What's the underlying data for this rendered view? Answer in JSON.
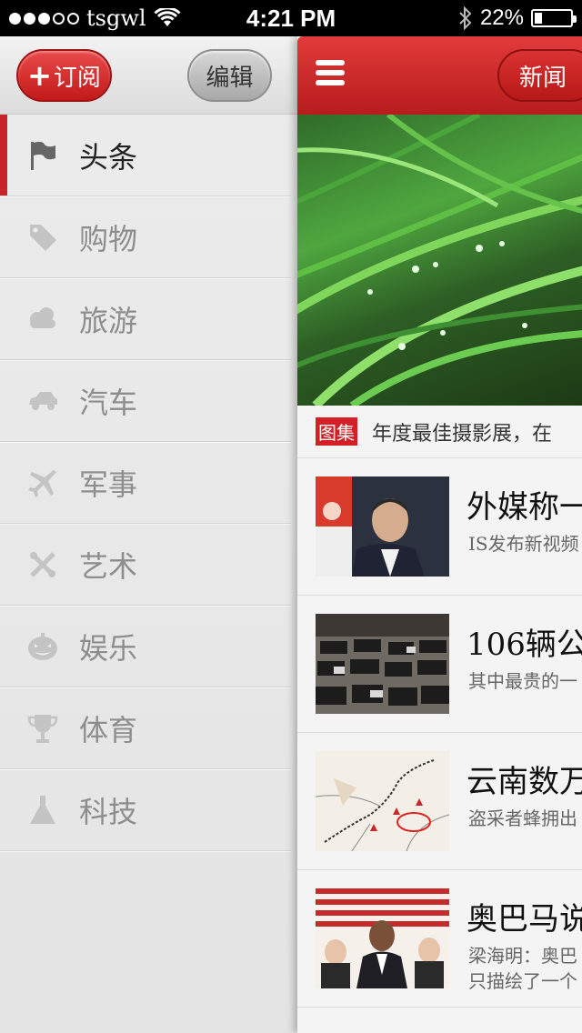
{
  "status_bar": {
    "carrier": "tsgwl",
    "time": "4:21 PM",
    "battery_percent": "22%",
    "battery_level": 0.22,
    "signal_bars_filled": 3,
    "signal_bars_total": 5
  },
  "sidebar": {
    "subscribe_label": "订阅",
    "edit_label": "编辑",
    "items": [
      {
        "label": "头条",
        "icon": "flag-icon",
        "active": true
      },
      {
        "label": "购物",
        "icon": "tag-icon",
        "active": false
      },
      {
        "label": "旅游",
        "icon": "cloud-icon",
        "active": false
      },
      {
        "label": "汽车",
        "icon": "car-icon",
        "active": false
      },
      {
        "label": "军事",
        "icon": "airplane-icon",
        "active": false
      },
      {
        "label": "艺术",
        "icon": "art-icon",
        "active": false
      },
      {
        "label": "娱乐",
        "icon": "pumpkin-icon",
        "active": false
      },
      {
        "label": "体育",
        "icon": "trophy-icon",
        "active": false
      },
      {
        "label": "科技",
        "icon": "flask-icon",
        "active": false
      }
    ]
  },
  "main": {
    "tab_label": "新闻",
    "hero_tag": "图集",
    "hero_caption": "年度最佳摄影展，在",
    "news": [
      {
        "title": "外媒称一",
        "subtitle": "IS发布新视频",
        "subtitle2": ""
      },
      {
        "title": "106辆公",
        "subtitle": "其中最贵的一",
        "subtitle2": ""
      },
      {
        "title": "云南数万",
        "subtitle": "盗采者蜂拥出",
        "subtitle2": ""
      },
      {
        "title": "奥巴马说",
        "subtitle": "梁海明：奥巴",
        "subtitle2": "只描绘了一个"
      }
    ]
  },
  "colors": {
    "accent_red": "#c9242a",
    "sidebar_bg": "#e8e8e8",
    "main_bg": "#f4f4f4"
  }
}
